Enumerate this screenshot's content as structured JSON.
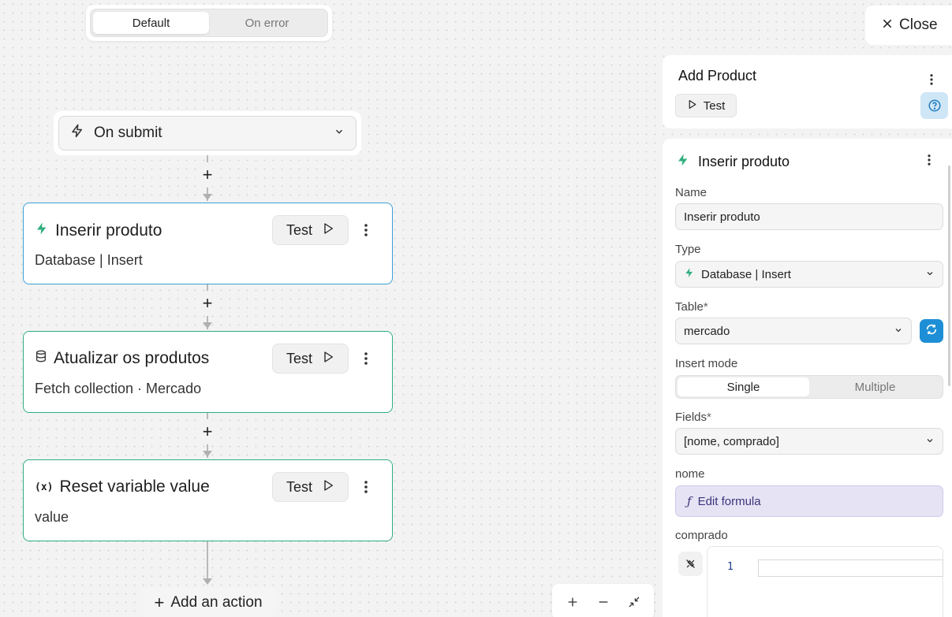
{
  "toggle": {
    "options": [
      "Default",
      "On error"
    ],
    "active": "Default"
  },
  "trigger": {
    "label": "On submit",
    "icon": "lightning-icon"
  },
  "actions": [
    {
      "title": "Inserir produto",
      "subtitle": "Database | Insert",
      "icon": "lightning-icon",
      "test_label": "Test"
    },
    {
      "title": "Atualizar os produtos",
      "subtitle": "Fetch collection · Mercado",
      "icon": "database-icon",
      "test_label": "Test"
    },
    {
      "title": "Reset variable value",
      "subtitle": "value",
      "icon": "variable-icon",
      "test_label": "Test"
    }
  ],
  "add_action_label": "Add an action",
  "close_label": "Close",
  "panel": {
    "workflow_title": "Add Product",
    "test_label": "Test",
    "action_title": "Inserir produto",
    "name_label": "Name",
    "name_value": "Inserir produto",
    "type_label": "Type",
    "type_value": "Database | Insert",
    "table_label": "Table",
    "table_value": "mercado",
    "insert_mode_label": "Insert mode",
    "insert_mode_options": [
      "Single",
      "Multiple"
    ],
    "insert_mode_active": "Single",
    "fields_label": "Fields",
    "fields_value": "[nome, comprado]",
    "nome_label": "nome",
    "formula_label": "Edit formula",
    "comprado_label": "comprado",
    "code_line_number": "1",
    "required_mark": "*"
  },
  "colors": {
    "accent_green": "#2fae7e",
    "selected_blue": "#3aa0d8",
    "refresh_blue": "#1e8fd6",
    "formula_bg": "#e6e3f5"
  }
}
